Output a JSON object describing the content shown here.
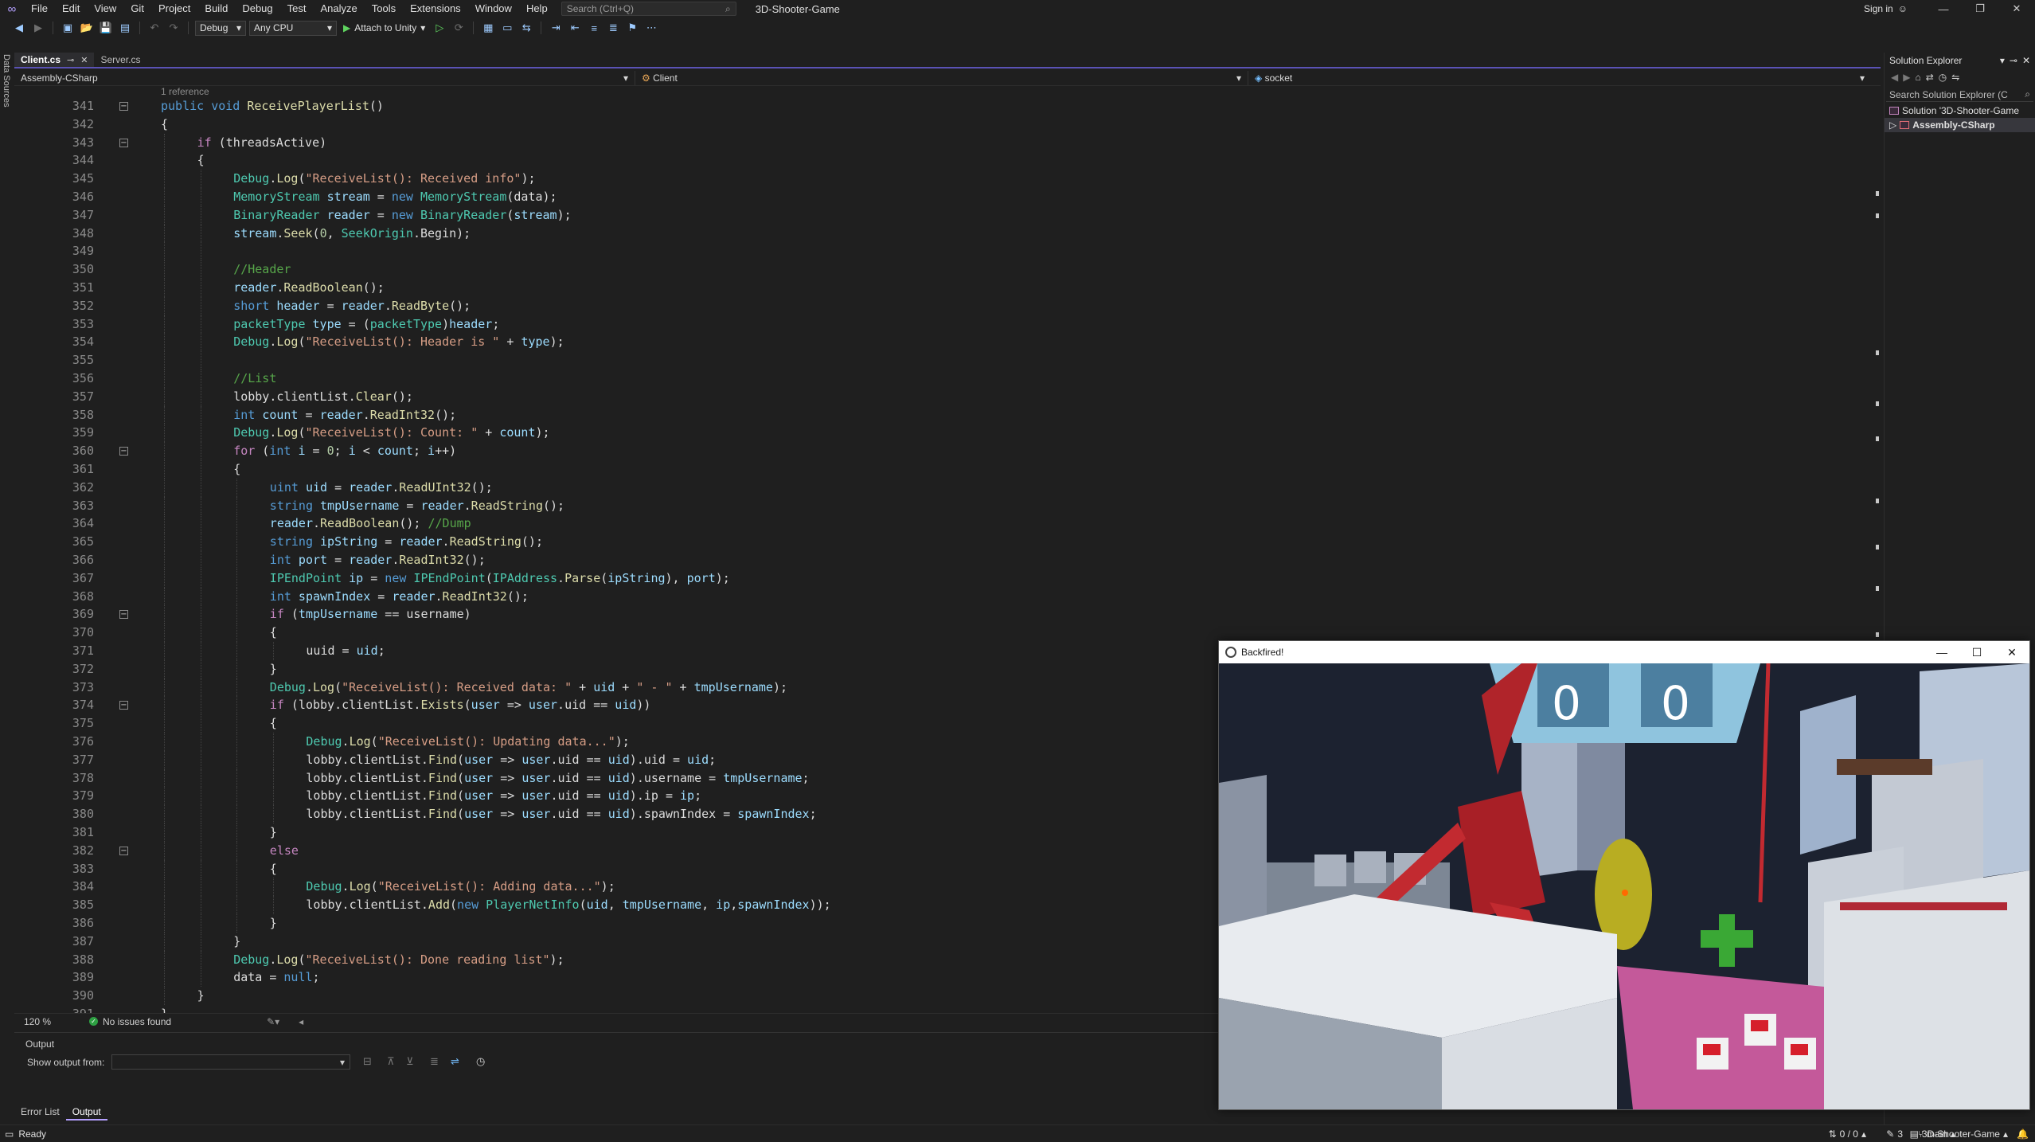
{
  "menubar": {
    "items": [
      "File",
      "Edit",
      "View",
      "Git",
      "Project",
      "Build",
      "Debug",
      "Test",
      "Analyze",
      "Tools",
      "Extensions",
      "Window",
      "Help"
    ],
    "search_placeholder": "Search (Ctrl+Q)",
    "solution_name": "3D-Shooter-Game",
    "sign_in": "Sign in"
  },
  "toolbar": {
    "configuration": "Debug",
    "platform": "Any CPU",
    "attach_label": "Attach to Unity"
  },
  "left_strip": {
    "label": "Data Sources"
  },
  "editor": {
    "tabs": [
      {
        "label": "Client.cs",
        "active": true
      },
      {
        "label": "Server.cs",
        "active": false
      }
    ],
    "nav": {
      "project": "Assembly-CSharp",
      "type": "Client",
      "member": "socket"
    },
    "codelens": "1 reference",
    "zoom": "120 %",
    "issues": "No issues found",
    "lines": [
      {
        "n": "341",
        "indent": 0,
        "fold": "-",
        "html": "<span style=\"color:#569cd6\">public</span> <span style=\"color:#569cd6\">void</span> <span style=\"color:#dcdcaa\">ReceivePlayerList</span>()"
      },
      {
        "n": "342",
        "indent": 0,
        "html": "{"
      },
      {
        "n": "343",
        "indent": 1,
        "fold": "-",
        "html": "<span style=\"color:#c586c0\">if</span> (threadsActive)"
      },
      {
        "n": "344",
        "indent": 1,
        "html": "{"
      },
      {
        "n": "345",
        "indent": 2,
        "html": "<span style=\"color:#4ec9b0\">Debug</span>.<span style=\"color:#dcdcaa\">Log</span>(<span style=\"color:#d69d85\">\"ReceiveList(): Received info\"</span>);"
      },
      {
        "n": "346",
        "indent": 2,
        "html": "<span style=\"color:#4ec9b0\">MemoryStream</span> <span style=\"color:#9cdcfe\">stream</span> = <span style=\"color:#569cd6\">new</span> <span style=\"color:#4ec9b0\">MemoryStream</span>(data);"
      },
      {
        "n": "347",
        "indent": 2,
        "html": "<span style=\"color:#4ec9b0\">BinaryReader</span> <span style=\"color:#9cdcfe\">reader</span> = <span style=\"color:#569cd6\">new</span> <span style=\"color:#4ec9b0\">BinaryReader</span>(<span style=\"color:#9cdcfe\">stream</span>);"
      },
      {
        "n": "348",
        "indent": 2,
        "html": "<span style=\"color:#9cdcfe\">stream</span>.<span style=\"color:#dcdcaa\">Seek</span>(<span style=\"color:#b5cea8\">0</span>, <span style=\"color:#4ec9b0\">SeekOrigin</span>.Begin);"
      },
      {
        "n": "349",
        "indent": 2,
        "html": ""
      },
      {
        "n": "350",
        "indent": 2,
        "html": "<span style=\"color:#57a64a\">//Header</span>"
      },
      {
        "n": "351",
        "indent": 2,
        "html": "<span style=\"color:#9cdcfe\">reader</span>.<span style=\"color:#dcdcaa\">ReadBoolean</span>();"
      },
      {
        "n": "352",
        "indent": 2,
        "html": "<span style=\"color:#569cd6\">short</span> <span style=\"color:#9cdcfe\">header</span> = <span style=\"color:#9cdcfe\">reader</span>.<span style=\"color:#dcdcaa\">ReadByte</span>();"
      },
      {
        "n": "353",
        "indent": 2,
        "html": "<span style=\"color:#4ec9b0\">packetType</span> <span style=\"color:#9cdcfe\">type</span> = (<span style=\"color:#4ec9b0\">packetType</span>)<span style=\"color:#9cdcfe\">header</span>;"
      },
      {
        "n": "354",
        "indent": 2,
        "html": "<span style=\"color:#4ec9b0\">Debug</span>.<span style=\"color:#dcdcaa\">Log</span>(<span style=\"color:#d69d85\">\"ReceiveList(): Header is \"</span> + <span style=\"color:#9cdcfe\">type</span>);"
      },
      {
        "n": "355",
        "indent": 2,
        "html": ""
      },
      {
        "n": "356",
        "indent": 2,
        "html": "<span style=\"color:#57a64a\">//List</span>"
      },
      {
        "n": "357",
        "indent": 2,
        "html": "lobby.clientList.<span style=\"color:#dcdcaa\">Clear</span>();"
      },
      {
        "n": "358",
        "indent": 2,
        "html": "<span style=\"color:#569cd6\">int</span> <span style=\"color:#9cdcfe\">count</span> = <span style=\"color:#9cdcfe\">reader</span>.<span style=\"color:#dcdcaa\">ReadInt32</span>();"
      },
      {
        "n": "359",
        "indent": 2,
        "html": "<span style=\"color:#4ec9b0\">Debug</span>.<span style=\"color:#dcdcaa\">Log</span>(<span style=\"color:#d69d85\">\"ReceiveList(): Count: \"</span> + <span style=\"color:#9cdcfe\">count</span>);"
      },
      {
        "n": "360",
        "indent": 2,
        "fold": "-",
        "html": "<span style=\"color:#c586c0\">for</span> (<span style=\"color:#569cd6\">int</span> <span style=\"color:#9cdcfe\">i</span> = <span style=\"color:#b5cea8\">0</span>; <span style=\"color:#9cdcfe\">i</span> &lt; <span style=\"color:#9cdcfe\">count</span>; <span style=\"color:#9cdcfe\">i</span>++)"
      },
      {
        "n": "361",
        "indent": 2,
        "html": "{"
      },
      {
        "n": "362",
        "indent": 3,
        "html": "<span style=\"color:#569cd6\">uint</span> <span style=\"color:#9cdcfe\">uid</span> = <span style=\"color:#9cdcfe\">reader</span>.<span style=\"color:#dcdcaa\">ReadUInt32</span>();"
      },
      {
        "n": "363",
        "indent": 3,
        "html": "<span style=\"color:#569cd6\">string</span> <span style=\"color:#9cdcfe\">tmpUsername</span> = <span style=\"color:#9cdcfe\">reader</span>.<span style=\"color:#dcdcaa\">ReadString</span>();"
      },
      {
        "n": "364",
        "indent": 3,
        "html": "<span style=\"color:#9cdcfe\">reader</span>.<span style=\"color:#dcdcaa\">ReadBoolean</span>(); <span style=\"color:#57a64a\">//Dump</span>"
      },
      {
        "n": "365",
        "indent": 3,
        "html": "<span style=\"color:#569cd6\">string</span> <span style=\"color:#9cdcfe\">ipString</span> = <span style=\"color:#9cdcfe\">reader</span>.<span style=\"color:#dcdcaa\">ReadString</span>();"
      },
      {
        "n": "366",
        "indent": 3,
        "html": "<span style=\"color:#569cd6\">int</span> <span style=\"color:#9cdcfe\">port</span> = <span style=\"color:#9cdcfe\">reader</span>.<span style=\"color:#dcdcaa\">ReadInt32</span>();"
      },
      {
        "n": "367",
        "indent": 3,
        "html": "<span style=\"color:#4ec9b0\">IPEndPoint</span> <span style=\"color:#9cdcfe\">ip</span> = <span style=\"color:#569cd6\">new</span> <span style=\"color:#4ec9b0\">IPEndPoint</span>(<span style=\"color:#4ec9b0\">IPAddress</span>.<span style=\"color:#dcdcaa\">Parse</span>(<span style=\"color:#9cdcfe\">ipString</span>), <span style=\"color:#9cdcfe\">port</span>);"
      },
      {
        "n": "368",
        "indent": 3,
        "html": "<span style=\"color:#569cd6\">int</span> <span style=\"color:#9cdcfe\">spawnIndex</span> = <span style=\"color:#9cdcfe\">reader</span>.<span style=\"color:#dcdcaa\">ReadInt32</span>();"
      },
      {
        "n": "369",
        "indent": 3,
        "fold": "-",
        "html": "<span style=\"color:#c586c0\">if</span> (<span style=\"color:#9cdcfe\">tmpUsername</span> == username)"
      },
      {
        "n": "370",
        "indent": 3,
        "html": "{"
      },
      {
        "n": "371",
        "indent": 4,
        "html": "uuid = <span style=\"color:#9cdcfe\">uid</span>;"
      },
      {
        "n": "372",
        "indent": 3,
        "html": "}"
      },
      {
        "n": "373",
        "indent": 3,
        "html": "<span style=\"color:#4ec9b0\">Debug</span>.<span style=\"color:#dcdcaa\">Log</span>(<span style=\"color:#d69d85\">\"ReceiveList(): Received data: \"</span> + <span style=\"color:#9cdcfe\">uid</span> + <span style=\"color:#d69d85\">\" - \"</span> + <span style=\"color:#9cdcfe\">tmpUsername</span>);"
      },
      {
        "n": "374",
        "indent": 3,
        "fold": "-",
        "html": "<span style=\"color:#c586c0\">if</span> (lobby.clientList.<span style=\"color:#dcdcaa\">Exists</span>(<span style=\"color:#9cdcfe\">user</span> =&gt; <span style=\"color:#9cdcfe\">user</span>.uid == <span style=\"color:#9cdcfe\">uid</span>))"
      },
      {
        "n": "375",
        "indent": 3,
        "html": "{"
      },
      {
        "n": "376",
        "indent": 4,
        "html": "<span style=\"color:#4ec9b0\">Debug</span>.<span style=\"color:#dcdcaa\">Log</span>(<span style=\"color:#d69d85\">\"ReceiveList(): Updating data...\"</span>);"
      },
      {
        "n": "377",
        "indent": 4,
        "html": "lobby.clientList.<span style=\"color:#dcdcaa\">Find</span>(<span style=\"color:#9cdcfe\">user</span> =&gt; <span style=\"color:#9cdcfe\">user</span>.uid == <span style=\"color:#9cdcfe\">uid</span>).uid = <span style=\"color:#9cdcfe\">uid</span>;"
      },
      {
        "n": "378",
        "indent": 4,
        "html": "lobby.clientList.<span style=\"color:#dcdcaa\">Find</span>(<span style=\"color:#9cdcfe\">user</span> =&gt; <span style=\"color:#9cdcfe\">user</span>.uid == <span style=\"color:#9cdcfe\">uid</span>).username = <span style=\"color:#9cdcfe\">tmpUsername</span>;"
      },
      {
        "n": "379",
        "indent": 4,
        "html": "lobby.clientList.<span style=\"color:#dcdcaa\">Find</span>(<span style=\"color:#9cdcfe\">user</span> =&gt; <span style=\"color:#9cdcfe\">user</span>.uid == <span style=\"color:#9cdcfe\">uid</span>).ip = <span style=\"color:#9cdcfe\">ip</span>;"
      },
      {
        "n": "380",
        "indent": 4,
        "html": "lobby.clientList.<span style=\"color:#dcdcaa\">Find</span>(<span style=\"color:#9cdcfe\">user</span> =&gt; <span style=\"color:#9cdcfe\">user</span>.uid == <span style=\"color:#9cdcfe\">uid</span>).spawnIndex = <span style=\"color:#9cdcfe\">spawnIndex</span>;"
      },
      {
        "n": "381",
        "indent": 3,
        "html": "}"
      },
      {
        "n": "382",
        "indent": 3,
        "fold": "-",
        "html": "<span style=\"color:#c586c0\">else</span>"
      },
      {
        "n": "383",
        "indent": 3,
        "html": "{"
      },
      {
        "n": "384",
        "indent": 4,
        "html": "<span style=\"color:#4ec9b0\">Debug</span>.<span style=\"color:#dcdcaa\">Log</span>(<span style=\"color:#d69d85\">\"ReceiveList(): Adding data...\"</span>);"
      },
      {
        "n": "385",
        "indent": 4,
        "html": "lobby.clientList.<span style=\"color:#dcdcaa\">Add</span>(<span style=\"color:#569cd6\">new</span> <span style=\"color:#4ec9b0\">PlayerNetInfo</span>(<span style=\"color:#9cdcfe\">uid</span>, <span style=\"color:#9cdcfe\">tmpUsername</span>, <span style=\"color:#9cdcfe\">ip</span>,<span style=\"color:#9cdcfe\">spawnIndex</span>));"
      },
      {
        "n": "386",
        "indent": 3,
        "html": "}"
      },
      {
        "n": "387",
        "indent": 2,
        "html": "}"
      },
      {
        "n": "388",
        "indent": 2,
        "html": "<span style=\"color:#4ec9b0\">Debug</span>.<span style=\"color:#dcdcaa\">Log</span>(<span style=\"color:#d69d85\">\"ReceiveList(): Done reading list\"</span>);"
      },
      {
        "n": "389",
        "indent": 2,
        "html": "data = <span style=\"color:#569cd6\">null</span>;"
      },
      {
        "n": "390",
        "indent": 1,
        "html": "}"
      },
      {
        "n": "391",
        "indent": 0,
        "html": "}"
      }
    ]
  },
  "output_panel": {
    "title": "Output",
    "show_output_from": "Show output from:",
    "tabs": [
      {
        "label": "Error List",
        "active": false
      },
      {
        "label": "Output",
        "active": true
      }
    ]
  },
  "solution_explorer": {
    "title": "Solution Explorer",
    "search_placeholder": "Search Solution Explorer (C",
    "solution_node": "Solution '3D-Shooter-Game",
    "project_node": "Assembly-CSharp"
  },
  "statusbar": {
    "ready": "Ready",
    "line_changes": "0 / 0",
    "edits": "3",
    "branch": "main",
    "repo": "3D-Shooter-Game"
  },
  "game_window": {
    "title": "Backfired!",
    "score_left": "0",
    "score_right": "0"
  }
}
